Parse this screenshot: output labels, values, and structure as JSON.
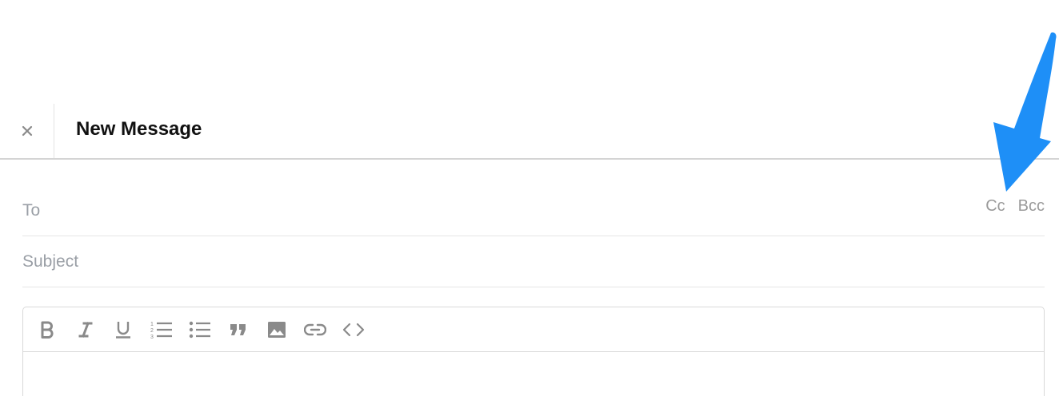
{
  "header": {
    "title": "New Message",
    "close_icon": "close-icon"
  },
  "fields": {
    "to": {
      "placeholder": "To",
      "value": ""
    },
    "subject": {
      "placeholder": "Subject",
      "value": ""
    },
    "cc_label": "Cc",
    "bcc_label": "Bcc"
  },
  "toolbar": {
    "tools": [
      "bold-icon",
      "italic-icon",
      "underline-icon",
      "numbered-list-icon",
      "bulleted-list-icon",
      "quote-icon",
      "image-icon",
      "link-icon",
      "code-icon"
    ]
  },
  "colors": {
    "icon": "#8a8a8a",
    "annotation_arrow": "#1e8ff7"
  }
}
